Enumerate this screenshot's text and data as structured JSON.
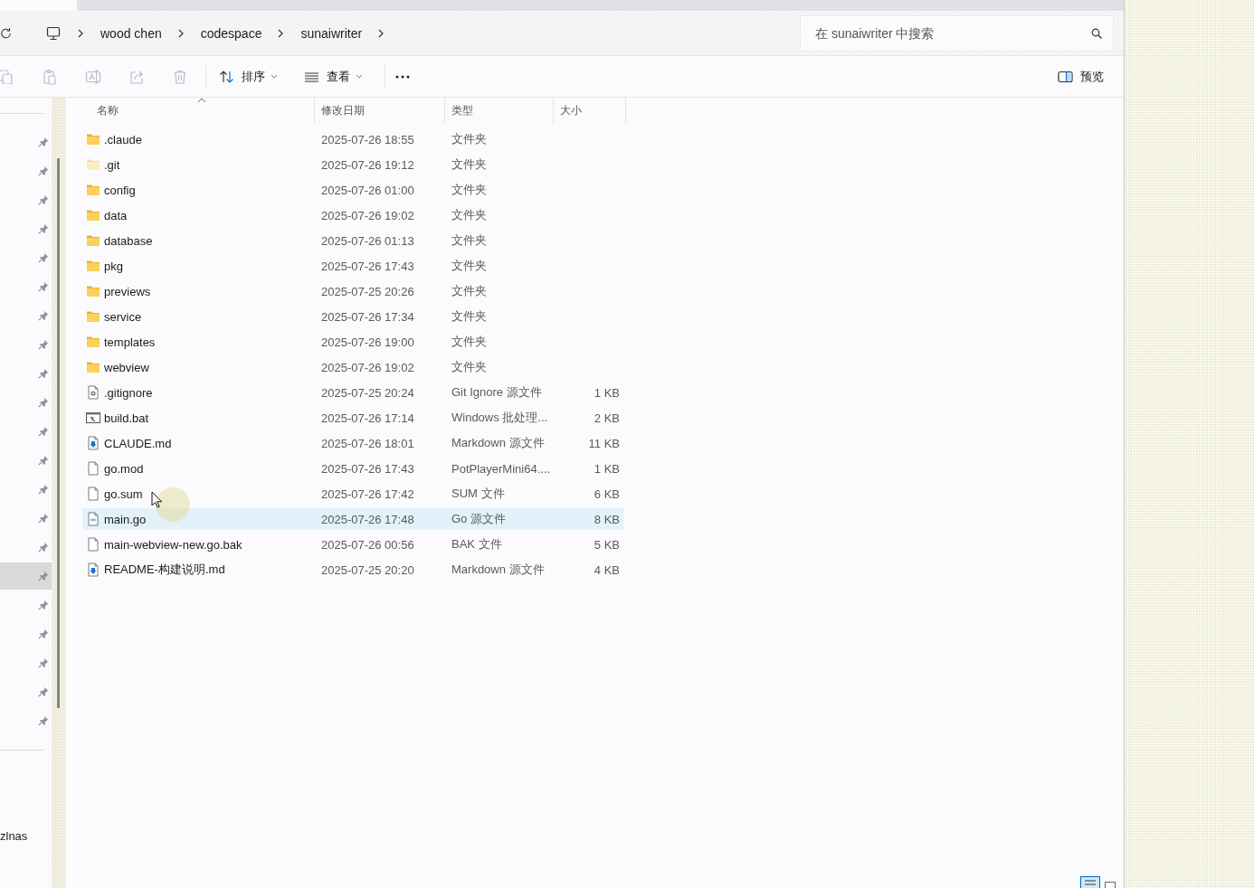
{
  "address_bar": {
    "breadcrumbs": [
      "wood chen",
      "codespace",
      "sunaiwriter"
    ],
    "search": {
      "placeholder": "在 sunaiwriter 中搜索"
    }
  },
  "toolbar": {
    "actions": [
      {
        "kind": "copy",
        "disabled": true
      },
      {
        "kind": "paste",
        "disabled": true
      },
      {
        "kind": "rename",
        "disabled": true
      },
      {
        "kind": "share",
        "disabled": true
      },
      {
        "kind": "delete",
        "disabled": true
      }
    ],
    "sort_button": {
      "label": "排序"
    },
    "view_button": {
      "label": "查看"
    },
    "preview_button": {
      "label": "预览"
    }
  },
  "sidebar": {
    "pinned_items": [
      {
        "selected": false
      },
      {
        "selected": false
      },
      {
        "selected": false
      },
      {
        "selected": false
      },
      {
        "selected": false
      },
      {
        "selected": false
      },
      {
        "selected": false
      },
      {
        "selected": false
      },
      {
        "selected": false
      },
      {
        "selected": false
      },
      {
        "selected": false
      },
      {
        "selected": false
      },
      {
        "selected": false
      },
      {
        "selected": false
      },
      {
        "selected": false
      },
      {
        "selected": true
      },
      {
        "selected": false
      },
      {
        "selected": false
      },
      {
        "selected": false
      },
      {
        "selected": false
      },
      {
        "selected": false
      }
    ],
    "bottom_item_label": "zlnas"
  },
  "file_list": {
    "columns": [
      {
        "label": "名称",
        "sorted": true
      },
      {
        "label": "修改日期",
        "sorted": false
      },
      {
        "label": "类型",
        "sorted": false
      },
      {
        "label": "大小",
        "sorted": false
      }
    ],
    "rows": [
      {
        "kind": "folder",
        "name": ".claude",
        "modified": "2025-07-26 18:55",
        "type": "文件夹",
        "hovered": false
      },
      {
        "kind": "hidden_folder",
        "name": ".git",
        "modified": "2025-07-26 19:12",
        "type": "文件夹",
        "hovered": false
      },
      {
        "kind": "folder",
        "name": "config",
        "modified": "2025-07-26 01:00",
        "type": "文件夹",
        "hovered": false
      },
      {
        "kind": "folder",
        "name": "data",
        "modified": "2025-07-26 19:02",
        "type": "文件夹",
        "hovered": false
      },
      {
        "kind": "folder",
        "name": "database",
        "modified": "2025-07-26 01:13",
        "type": "文件夹",
        "hovered": false
      },
      {
        "kind": "folder",
        "name": "pkg",
        "modified": "2025-07-26 17:43",
        "type": "文件夹",
        "hovered": false
      },
      {
        "kind": "folder",
        "name": "previews",
        "modified": "2025-07-25 20:26",
        "type": "文件夹",
        "hovered": false
      },
      {
        "kind": "folder",
        "name": "service",
        "modified": "2025-07-26 17:34",
        "type": "文件夹",
        "hovered": false
      },
      {
        "kind": "folder",
        "name": "templates",
        "modified": "2025-07-26 19:00",
        "type": "文件夹",
        "hovered": false
      },
      {
        "kind": "folder",
        "name": "webview",
        "modified": "2025-07-26 19:02",
        "type": "文件夹",
        "hovered": false
      },
      {
        "kind": "config",
        "name": ".gitignore",
        "modified": "2025-07-25 20:24",
        "type": "Git Ignore 源文件",
        "size": "1 KB",
        "hovered": false
      },
      {
        "kind": "batch",
        "name": "build.bat",
        "modified": "2025-07-26 17:14",
        "type": "Windows 批处理...",
        "size": "2 KB",
        "hovered": false
      },
      {
        "kind": "markdown",
        "name": "CLAUDE.md",
        "modified": "2025-07-26 18:01",
        "type": "Markdown 源文件",
        "size": "11 KB",
        "hovered": false
      },
      {
        "kind": "blank",
        "name": "go.mod",
        "modified": "2025-07-26 17:43",
        "type": "PotPlayerMini64....",
        "size": "1 KB",
        "hovered": false
      },
      {
        "kind": "blank",
        "name": "go.sum",
        "modified": "2025-07-26 17:42",
        "type": "SUM 文件",
        "size": "6 KB",
        "hovered": false
      },
      {
        "kind": "go",
        "name": "main.go",
        "modified": "2025-07-26 17:48",
        "type": "Go 源文件",
        "size": "8 KB",
        "hovered": true
      },
      {
        "kind": "blank",
        "name": "main-webview-new.go.bak",
        "modified": "2025-07-26 00:56",
        "type": "BAK 文件",
        "size": "5 KB",
        "hovered": false
      },
      {
        "kind": "markdown",
        "name": "README-构建说明.md",
        "modified": "2025-07-25 20:20",
        "type": "Markdown 源文件",
        "size": "4 KB",
        "hovered": false
      }
    ]
  },
  "view_modes": [
    {
      "kind": "details",
      "selected": true
    },
    {
      "kind": "tiles",
      "selected": false
    }
  ]
}
